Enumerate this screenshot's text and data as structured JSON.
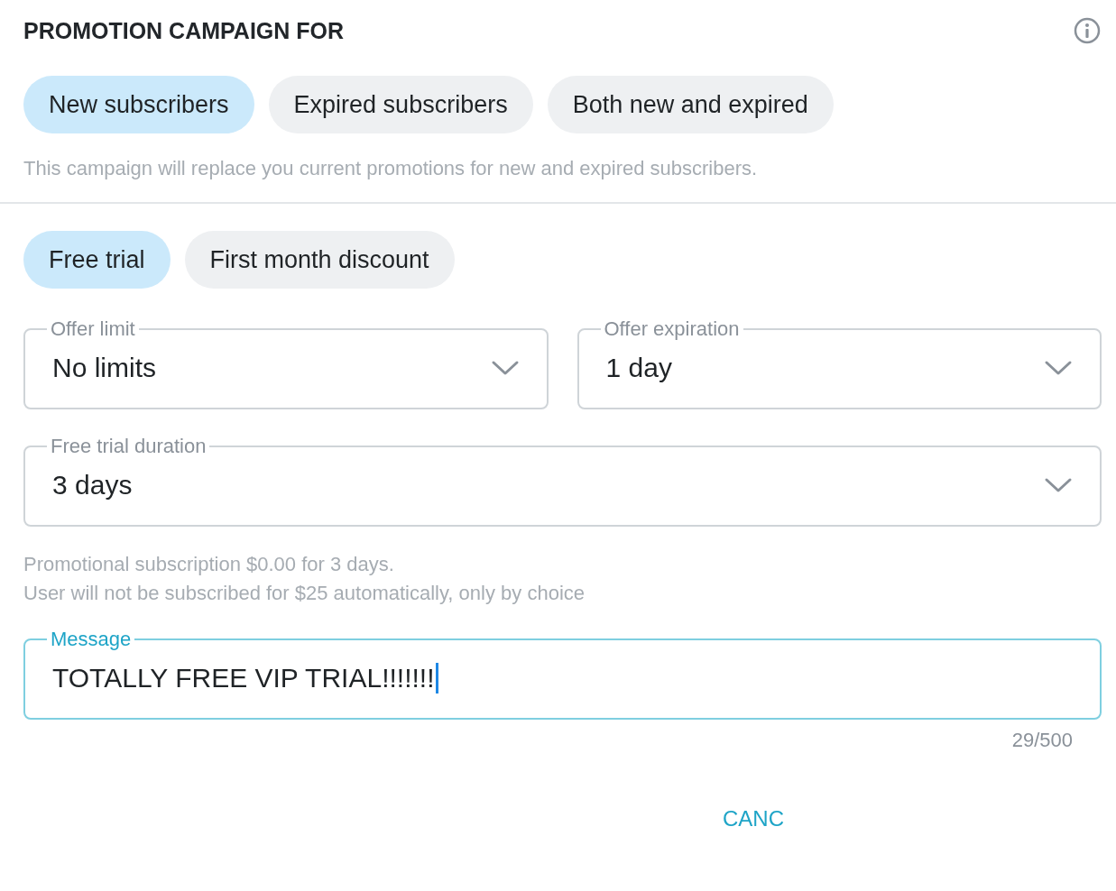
{
  "header": {
    "title": "PROMOTION CAMPAIGN FOR"
  },
  "audience_options": [
    {
      "label": "New subscribers",
      "selected": true
    },
    {
      "label": "Expired subscribers",
      "selected": false
    },
    {
      "label": "Both new and expired",
      "selected": false
    }
  ],
  "audience_note": "This campaign will replace you current promotions for new and expired subscribers.",
  "offer_types": [
    {
      "label": "Free trial",
      "selected": true
    },
    {
      "label": "First month discount",
      "selected": false
    }
  ],
  "field_rows": [
    [
      {
        "label": "Offer limit",
        "value": "No limits"
      },
      {
        "label": "Offer expiration",
        "value": "1 day"
      }
    ],
    [
      {
        "label": "Free trial duration",
        "value": "3 days"
      }
    ]
  ],
  "summary": [
    "Promotional subscription $0.00 for 3 days.",
    "User will not be subscribed for $25 automatically, only by choice"
  ],
  "message": {
    "label": "Message",
    "value": "TOTALLY FREE VIP TRIAL!!!!!!!",
    "focused": true,
    "counter": "29/500"
  },
  "actions": [
    {
      "label": "CANC"
    }
  ]
}
